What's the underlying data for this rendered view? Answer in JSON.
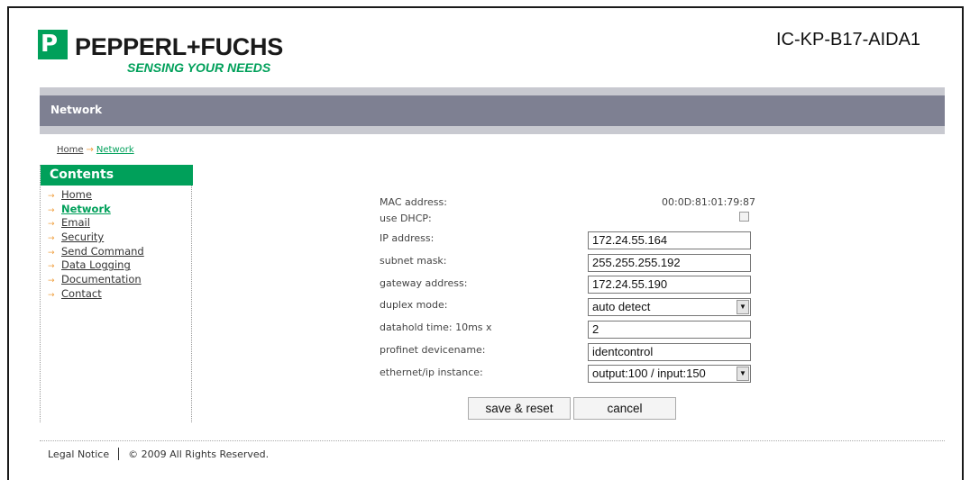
{
  "header": {
    "logo_glyph": "P",
    "brand": "PEPPERL+FUCHS",
    "tagline": "SENSING YOUR NEEDS",
    "device": "IC-KP-B17-AIDA1",
    "brand_color": "#00a05a"
  },
  "titlebar": {
    "title": "Network"
  },
  "breadcrumb": {
    "home": "Home",
    "arrow": "→",
    "current": "Network"
  },
  "sidebar": {
    "heading": "Contents",
    "bullet": "→",
    "items": [
      {
        "label": "Home"
      },
      {
        "label": "Network",
        "active": true
      },
      {
        "label": "Email"
      },
      {
        "label": "Security"
      },
      {
        "label": "Send Command"
      },
      {
        "label": "Data Logging"
      },
      {
        "label": "Documentation"
      },
      {
        "label": "Contact"
      }
    ]
  },
  "form": {
    "mac_label": "MAC address:",
    "mac_value": "00:0D:81:01:79:87",
    "dhcp_label": "use DHCP:",
    "dhcp_checked": false,
    "ip_label": "IP address:",
    "ip_value": "172.24.55.164",
    "subnet_label": "subnet mask:",
    "subnet_value": "255.255.255.192",
    "gateway_label": "gateway address:",
    "gateway_value": "172.24.55.190",
    "duplex_label": "duplex mode:",
    "duplex_value": "auto detect",
    "datahold_label": "datahold time: 10ms x",
    "datahold_value": "2",
    "profinet_label": "profinet devicename:",
    "profinet_value": "identcontrol",
    "eip_label": "ethernet/ip instance:",
    "eip_value": "output:100 / input:150",
    "dropdown_glyph": "▼"
  },
  "buttons": {
    "save": "save & reset",
    "cancel": "cancel"
  },
  "footer": {
    "legal": "Legal Notice",
    "copyright": "© 2009 All Rights Reserved."
  }
}
